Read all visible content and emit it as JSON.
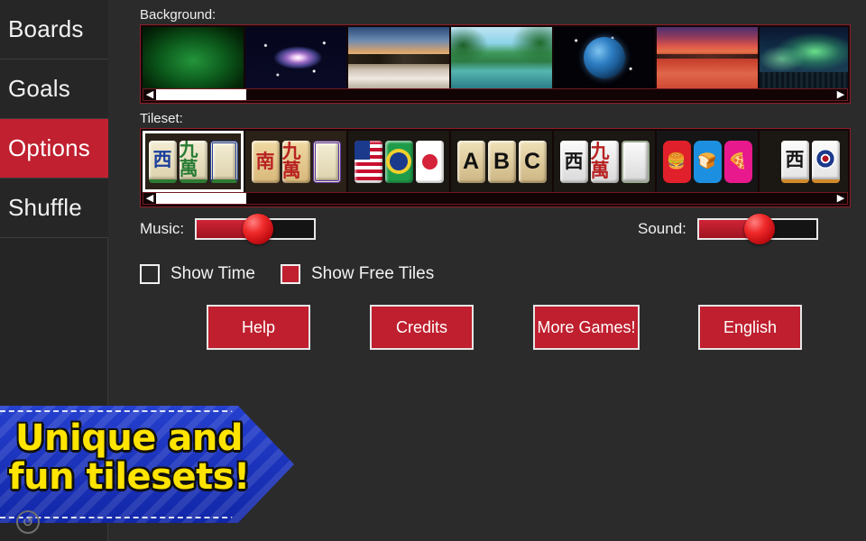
{
  "sidebar": {
    "items": [
      {
        "label": "Boards",
        "active": false
      },
      {
        "label": "Goals",
        "active": false
      },
      {
        "label": "Options",
        "active": true
      },
      {
        "label": "Shuffle",
        "active": false
      }
    ]
  },
  "background": {
    "label": "Background:",
    "selected_index": 0,
    "thumbnails": [
      {
        "name": "green-gradient",
        "selected": true
      },
      {
        "name": "galaxy",
        "selected": false
      },
      {
        "name": "beach-sunset",
        "selected": false
      },
      {
        "name": "tropical-lake",
        "selected": false
      },
      {
        "name": "earth-from-space",
        "selected": false
      },
      {
        "name": "red-desert",
        "selected": false
      },
      {
        "name": "aurora-borealis",
        "selected": false
      }
    ],
    "scrollbar": {
      "left_arrow": "◀",
      "right_arrow": "▶"
    }
  },
  "tileset": {
    "label": "Tileset:",
    "selected_index": 0,
    "thumbnails": [
      {
        "name": "classic-ivory",
        "selected": true,
        "tiles": [
          "西",
          "九萬",
          "frame"
        ]
      },
      {
        "name": "gold-bamboo",
        "selected": false,
        "tiles": [
          "南",
          "九萬",
          "frame"
        ]
      },
      {
        "name": "world-flags",
        "selected": false,
        "tiles": [
          "USA",
          "Brazil",
          "Japan"
        ]
      },
      {
        "name": "abc-letters",
        "selected": false,
        "tiles": [
          "A",
          "B",
          "C"
        ]
      },
      {
        "name": "white-stone",
        "selected": false,
        "tiles": [
          "西",
          "九萬",
          "frame"
        ]
      },
      {
        "name": "food-icons",
        "selected": false,
        "tiles": [
          "burger",
          "bread",
          "pizza"
        ]
      },
      {
        "name": "emblem-white",
        "selected": false,
        "tiles": [
          "西",
          "emblem",
          ""
        ]
      }
    ],
    "scrollbar": {
      "left_arrow": "◀",
      "right_arrow": "▶"
    }
  },
  "audio": {
    "music": {
      "label": "Music:",
      "value": 52
    },
    "sound": {
      "label": "Sound:",
      "value": 52
    }
  },
  "toggles": [
    {
      "label": "Show Time",
      "checked": false
    },
    {
      "label": "Show Free Tiles",
      "checked": true
    }
  ],
  "buttons": {
    "help": "Help",
    "credits": "Credits",
    "more_games": "More Games!",
    "language": "English"
  },
  "promo": {
    "line1": "Unique and",
    "line2": "fun tilesets!"
  },
  "colors": {
    "accent_red": "#c0202f",
    "button_red": "#bf1f2e",
    "background": "#2b2b2b",
    "sidebar": "#262626",
    "promo_blue": "#2540cf",
    "promo_yellow": "#ffe400"
  }
}
